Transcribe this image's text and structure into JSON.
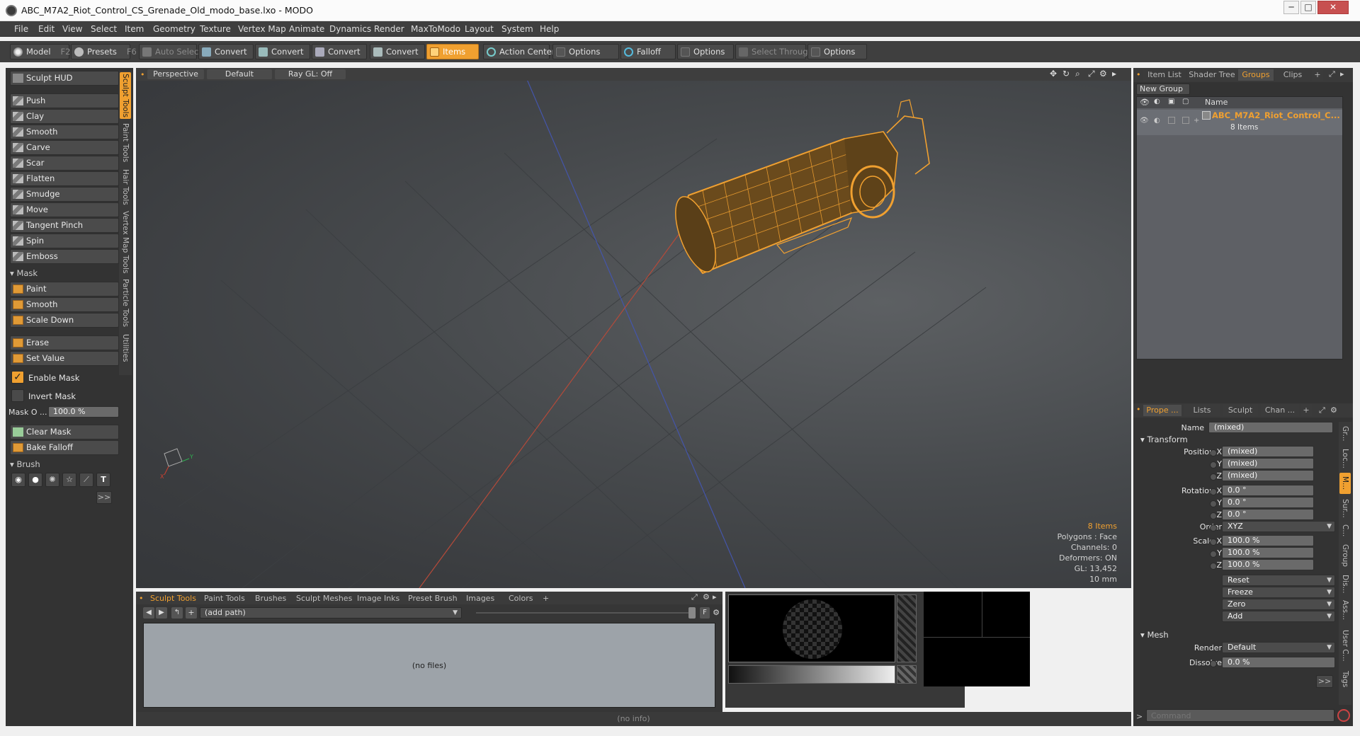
{
  "window": {
    "title": "ABC_M7A2_Riot_Control_CS_Grenade_Old_modo_base.lxo - MODO",
    "minimize": "─",
    "maximize": "□",
    "close": "✕"
  },
  "menu": [
    "File",
    "Edit",
    "View",
    "Select",
    "Item",
    "Geometry",
    "Texture",
    "Vertex Map",
    "Animate",
    "Dynamics",
    "Render",
    "MaxToModo",
    "Layout",
    "System",
    "Help"
  ],
  "toolbar": {
    "model": "Model",
    "model_key": "F2",
    "presets": "Presets",
    "presets_key": "F6",
    "auto_select": "Auto Select",
    "convert": "Convert",
    "items": "Items",
    "action_center": "Action Center",
    "options": "Options",
    "falloff": "Falloff",
    "select_through": "Select Through"
  },
  "left": {
    "sculpt_hud": "Sculpt HUD",
    "tools": [
      "Push",
      "Clay",
      "Smooth",
      "Carve",
      "Scar",
      "Flatten",
      "Smudge",
      "Move",
      "Tangent Pinch",
      "Spin",
      "Emboss"
    ],
    "mask_section": "Mask",
    "mask_tools": [
      "Paint",
      "Smooth",
      "Scale Down"
    ],
    "erase": "Erase",
    "set_value": "Set Value",
    "enable_mask": "Enable Mask",
    "invert_mask": "Invert Mask",
    "mask_opacity_label": "Mask O ...",
    "mask_opacity_value": "100.0 %",
    "clear_mask": "Clear Mask",
    "bake_falloff": "Bake Falloff",
    "brush_section": "Brush",
    "more": ">>"
  },
  "vtabs": [
    "Sculpt Tools",
    "Paint Tools",
    "Hair Tools",
    "Vertex Map Tools",
    "Particle Tools",
    "Utilities"
  ],
  "viewport": {
    "view": "Perspective",
    "shading": "Default",
    "raygl": "Ray GL: Off",
    "info": [
      "8 Items",
      "Polygons : Face",
      "Channels: 0",
      "Deformers: ON",
      "GL: 13,452",
      "10 mm"
    ]
  },
  "browser": {
    "tabs": [
      "Sculpt Tools",
      "Paint Tools",
      "Brushes",
      "Sculpt Meshes",
      "Image Inks",
      "Preset Brush",
      "Images",
      "Colors",
      "+"
    ],
    "path": "(add path)",
    "empty": "(no files)",
    "f_button": "F"
  },
  "status": "(no info)",
  "right": {
    "tabs_top": [
      "Item List",
      "Shader Tree",
      "Groups",
      "Clips",
      "+"
    ],
    "new_group": "New Group",
    "col_name": "Name",
    "group_name": "ABC_M7A2_Riot_Control_C...",
    "group_count": "8 Items",
    "tabs_bottom": [
      "Prope ...",
      "Lists",
      "Sculpt",
      "Chan ...",
      "+"
    ],
    "name_label": "Name",
    "name_value": "(mixed)",
    "transform": "Transform",
    "position_x_label": "Position X",
    "y_label": "Y",
    "z_label": "Z",
    "mixed": "(mixed)",
    "rotation_x_label": "Rotation X",
    "rot_val": "0.0 °",
    "order_label": "Order",
    "order_val": "XYZ",
    "scale_x_label": "Scale X",
    "scale_val": "100.0 %",
    "reset": "Reset",
    "freeze": "Freeze",
    "zero": "Zero",
    "add": "Add",
    "mesh": "Mesh",
    "render_label": "Render",
    "render_val": "Default",
    "dissolve_label": "Dissolve",
    "dissolve_val": "0.0 %",
    "more": ">>",
    "side_tabs": [
      "Gr...",
      "Loc...",
      "M...",
      "Sur...",
      "C...",
      "Group",
      "Dis...",
      "Ass...",
      "User C...",
      "Tags"
    ],
    "command_prompt": ">",
    "command_placeholder": "Command"
  },
  "colors": {
    "accent": "#f0a030",
    "panel": "#333333",
    "field": "#6a6a6a"
  }
}
